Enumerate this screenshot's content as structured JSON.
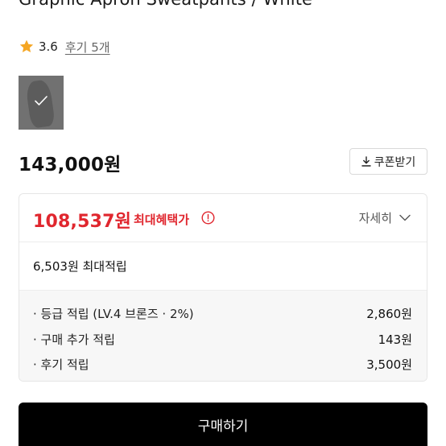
{
  "product": {
    "title": "Graphic Apron Sweatpants / White",
    "rating": "3.6",
    "review_link": "후기 5개",
    "price": "143,000원"
  },
  "coupon": {
    "label": "쿠폰받기"
  },
  "benefit": {
    "max_price": "108,537원",
    "max_label": "최대혜택가",
    "detail_label": "자세히",
    "points_total": "6,503원 최대적립",
    "rows": [
      {
        "label": "· 등급 적립 (LV.4 브론즈 · 2%)",
        "amount": "2,860원"
      },
      {
        "label": "· 구매 추가 적립",
        "amount": "143원"
      },
      {
        "label": "· 후기 적립",
        "amount": "3,500원"
      }
    ]
  },
  "buy": {
    "label": "구매하기"
  },
  "colors": {
    "accent_red": "#e0262e",
    "star": "#f5a623",
    "button_bg": "#000000"
  },
  "icons": [
    "star-icon",
    "check-icon",
    "download-icon",
    "info-icon",
    "chevron-down-icon"
  ]
}
